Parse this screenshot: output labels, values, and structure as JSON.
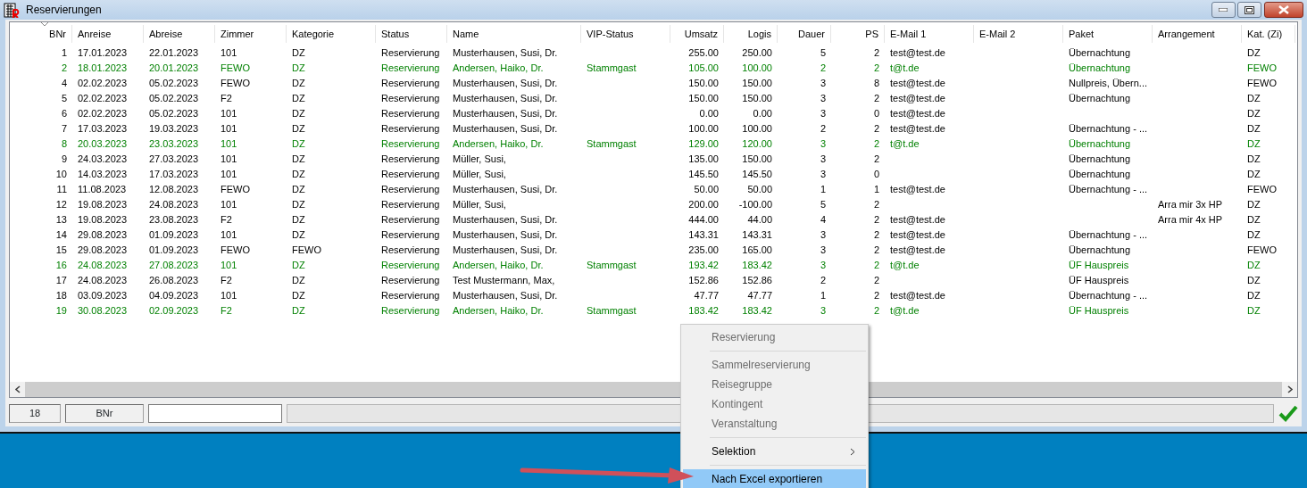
{
  "window": {
    "title": "Reservierungen"
  },
  "table": {
    "columns": [
      "BNr",
      "Anreise",
      "Abreise",
      "Zimmer",
      "Kategorie",
      "Status",
      "Name",
      "VIP-Status",
      "Umsatz",
      "Logis",
      "Dauer",
      "PS",
      "E-Mail 1",
      "E-Mail 2",
      "Paket",
      "Arrangement",
      "Kat. (Zi)"
    ],
    "rows": [
      {
        "color": "#000000",
        "cells": [
          "1",
          "17.01.2023",
          "22.01.2023",
          "101",
          "DZ",
          "Reservierung",
          "Musterhausen, Susi, Dr.",
          "",
          "255.00",
          "250.00",
          "5",
          "2",
          "test@test.de",
          "",
          "Übernachtung",
          "",
          "DZ"
        ]
      },
      {
        "color": "#008000",
        "cells": [
          "2",
          "18.01.2023",
          "20.01.2023",
          "FEWO",
          "DZ",
          "Reservierung",
          "Andersen, Haiko, Dr.",
          "Stammgast",
          "105.00",
          "100.00",
          "2",
          "2",
          "t@t.de",
          "",
          "Übernachtung",
          "",
          "FEWO"
        ]
      },
      {
        "color": "#000000",
        "cells": [
          "4",
          "02.02.2023",
          "05.02.2023",
          "FEWO",
          "DZ",
          "Reservierung",
          "Musterhausen, Susi, Dr.",
          "",
          "150.00",
          "150.00",
          "3",
          "8",
          "test@test.de",
          "",
          "Nullpreis, Übern...",
          "",
          "FEWO"
        ]
      },
      {
        "color": "#000000",
        "cells": [
          "5",
          "02.02.2023",
          "05.02.2023",
          "F2",
          "DZ",
          "Reservierung",
          "Musterhausen, Susi, Dr.",
          "",
          "150.00",
          "150.00",
          "3",
          "2",
          "test@test.de",
          "",
          "Übernachtung",
          "",
          "DZ"
        ]
      },
      {
        "color": "#000000",
        "cells": [
          "6",
          "02.02.2023",
          "05.02.2023",
          "101",
          "DZ",
          "Reservierung",
          "Musterhausen, Susi, Dr.",
          "",
          "0.00",
          "0.00",
          "3",
          "0",
          "test@test.de",
          "",
          "",
          "",
          "DZ"
        ]
      },
      {
        "color": "#000000",
        "cells": [
          "7",
          "17.03.2023",
          "19.03.2023",
          "101",
          "DZ",
          "Reservierung",
          "Musterhausen, Susi, Dr.",
          "",
          "100.00",
          "100.00",
          "2",
          "2",
          "test@test.de",
          "",
          "Übernachtung - ...",
          "",
          "DZ"
        ]
      },
      {
        "color": "#008000",
        "cells": [
          "8",
          "20.03.2023",
          "23.03.2023",
          "101",
          "DZ",
          "Reservierung",
          "Andersen, Haiko, Dr.",
          "Stammgast",
          "129.00",
          "120.00",
          "3",
          "2",
          "t@t.de",
          "",
          "Übernachtung",
          "",
          "DZ"
        ]
      },
      {
        "color": "#000000",
        "cells": [
          "9",
          "24.03.2023",
          "27.03.2023",
          "101",
          "DZ",
          "Reservierung",
          "Müller, Susi,",
          "",
          "135.00",
          "150.00",
          "3",
          "2",
          "",
          "",
          "Übernachtung",
          "",
          "DZ"
        ]
      },
      {
        "color": "#000000",
        "cells": [
          "10",
          "14.03.2023",
          "17.03.2023",
          "101",
          "DZ",
          "Reservierung",
          "Müller, Susi,",
          "",
          "145.50",
          "145.50",
          "3",
          "0",
          "",
          "",
          "Übernachtung",
          "",
          "DZ"
        ]
      },
      {
        "color": "#000000",
        "cells": [
          "11",
          "11.08.2023",
          "12.08.2023",
          "FEWO",
          "DZ",
          "Reservierung",
          "Musterhausen, Susi, Dr.",
          "",
          "50.00",
          "50.00",
          "1",
          "1",
          "test@test.de",
          "",
          "Übernachtung - ...",
          "",
          "FEWO"
        ]
      },
      {
        "color": "#000000",
        "cells": [
          "12",
          "19.08.2023",
          "24.08.2023",
          "101",
          "DZ",
          "Reservierung",
          "Müller, Susi,",
          "",
          "200.00",
          "-100.00",
          "5",
          "2",
          "",
          "",
          "",
          "Arra mir 3x HP",
          "DZ"
        ]
      },
      {
        "color": "#000000",
        "cells": [
          "13",
          "19.08.2023",
          "23.08.2023",
          "F2",
          "DZ",
          "Reservierung",
          "Musterhausen, Susi, Dr.",
          "",
          "444.00",
          "44.00",
          "4",
          "2",
          "test@test.de",
          "",
          "",
          "Arra mir 4x HP",
          "DZ"
        ]
      },
      {
        "color": "#000000",
        "cells": [
          "14",
          "29.08.2023",
          "01.09.2023",
          "101",
          "DZ",
          "Reservierung",
          "Musterhausen, Susi, Dr.",
          "",
          "143.31",
          "143.31",
          "3",
          "2",
          "test@test.de",
          "",
          "Übernachtung - ...",
          "",
          "DZ"
        ]
      },
      {
        "color": "#000000",
        "cells": [
          "15",
          "29.08.2023",
          "01.09.2023",
          "FEWO",
          "FEWO",
          "Reservierung",
          "Musterhausen, Susi, Dr.",
          "",
          "235.00",
          "165.00",
          "3",
          "2",
          "test@test.de",
          "",
          "Übernachtung",
          "",
          "FEWO"
        ]
      },
      {
        "color": "#008000",
        "cells": [
          "16",
          "24.08.2023",
          "27.08.2023",
          "101",
          "DZ",
          "Reservierung",
          "Andersen, Haiko, Dr.",
          "Stammgast",
          "193.42",
          "183.42",
          "3",
          "2",
          "t@t.de",
          "",
          "ÜF Hauspreis",
          "",
          "DZ"
        ]
      },
      {
        "color": "#000000",
        "cells": [
          "17",
          "24.08.2023",
          "26.08.2023",
          "F2",
          "DZ",
          "Reservierung",
          "Test Mustermann, Max,",
          "",
          "152.86",
          "152.86",
          "2",
          "2",
          "",
          "",
          "ÜF Hauspreis",
          "",
          "DZ"
        ]
      },
      {
        "color": "#000000",
        "cells": [
          "18",
          "03.09.2023",
          "04.09.2023",
          "101",
          "DZ",
          "Reservierung",
          "Musterhausen, Susi, Dr.",
          "",
          "47.77",
          "47.77",
          "1",
          "2",
          "test@test.de",
          "",
          "Übernachtung - ...",
          "",
          "DZ"
        ]
      },
      {
        "color": "#008000",
        "cells": [
          "19",
          "30.08.2023",
          "02.09.2023",
          "F2",
          "DZ",
          "Reservierung",
          "Andersen, Haiko, Dr.",
          "Stammgast",
          "183.42",
          "183.42",
          "3",
          "2",
          "t@t.de",
          "",
          "ÜF Hauspreis",
          "",
          "DZ"
        ]
      }
    ]
  },
  "status_bar": {
    "count": "18",
    "sort_field": "BNr"
  },
  "context_menu": [
    {
      "kind": "item",
      "label": "Reservierung",
      "disabled": true,
      "selected": false
    },
    {
      "kind": "separator"
    },
    {
      "kind": "item",
      "label": "Sammelreservierung",
      "disabled": true,
      "selected": false
    },
    {
      "kind": "item",
      "label": "Reisegruppe",
      "disabled": true,
      "selected": false
    },
    {
      "kind": "item",
      "label": "Kontingent",
      "disabled": true,
      "selected": false
    },
    {
      "kind": "item",
      "label": "Veranstaltung",
      "disabled": true,
      "selected": false
    },
    {
      "kind": "separator"
    },
    {
      "kind": "submenu",
      "label": "Selektion",
      "disabled": false,
      "selected": false
    },
    {
      "kind": "separator"
    },
    {
      "kind": "item",
      "label": "Nach Excel exportieren",
      "disabled": false,
      "selected": true
    }
  ]
}
